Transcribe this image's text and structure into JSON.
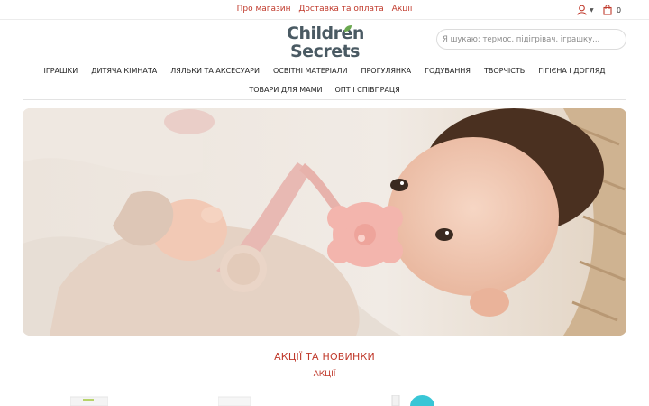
{
  "top_links": [
    "Про магазин",
    "Доставка та оплата",
    "Акції"
  ],
  "cart": {
    "count": "0"
  },
  "logo": {
    "line1": "Children",
    "line2": "Secrets"
  },
  "search": {
    "placeholder": "Я шукаю: термос, підігрівач, іграшку..."
  },
  "nav_row1": [
    "ІГРАШКИ",
    "ДИТЯЧА КІМНАТА",
    "ЛЯЛЬКИ ТА АКСЕСУАРИ",
    "ОСВІТНІ МАТЕРІАЛИ",
    "ПРОГУЛЯНКА",
    "ГОДУВАННЯ",
    "ТВОРЧІСТЬ",
    "ГІГІЄНА І ДОГЛЯД"
  ],
  "nav_row2": [
    "ТОВАРИ ДЛЯ МАМИ",
    "ОПТ І СПІВПРАЦЯ"
  ],
  "section": {
    "title": "АКЦІЇ ТА НОВИНКИ",
    "tab": "АКЦІЇ"
  },
  "icons": {
    "user": "user-icon",
    "cart": "shopping-bag-icon",
    "leaf": "leaf-icon"
  },
  "colors": {
    "accent": "#c0392b",
    "logo": "#4a5a63",
    "leaf": "#6aa84f",
    "badge": "#39c6d6"
  }
}
